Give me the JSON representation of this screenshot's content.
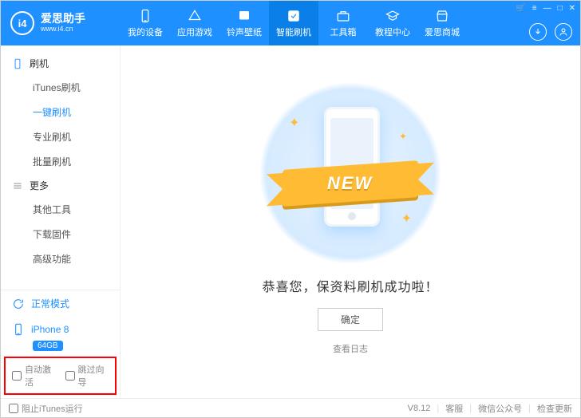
{
  "brand": {
    "logo_text": "i4",
    "title": "爱思助手",
    "subtitle": "www.i4.cn"
  },
  "tabs": [
    {
      "label": "我的设备"
    },
    {
      "label": "应用游戏"
    },
    {
      "label": "铃声壁纸"
    },
    {
      "label": "智能刷机"
    },
    {
      "label": "工具箱"
    },
    {
      "label": "教程中心"
    },
    {
      "label": "爱思商城"
    }
  ],
  "window_controls": {
    "cart": "🛒",
    "settings": "≡",
    "min": "—",
    "max": "□",
    "close": "✕"
  },
  "sidebar": {
    "flash": {
      "header": "刷机",
      "items": [
        "iTunes刷机",
        "一键刷机",
        "专业刷机",
        "批量刷机"
      ]
    },
    "more": {
      "header": "更多",
      "items": [
        "其他工具",
        "下载固件",
        "高级功能"
      ]
    },
    "mode": "正常模式",
    "device": {
      "name": "iPhone 8",
      "storage": "64GB"
    },
    "opts": {
      "auto_activate": "自动激活",
      "skip_guide": "跳过向导"
    }
  },
  "main": {
    "ribbon": "NEW",
    "message": "恭喜您，保资料刷机成功啦！",
    "ok": "确定",
    "log": "查看日志"
  },
  "footer": {
    "block_itunes": "阻止iTunes运行",
    "version": "V8.12",
    "links": [
      "客服",
      "微信公众号",
      "检查更新"
    ]
  }
}
